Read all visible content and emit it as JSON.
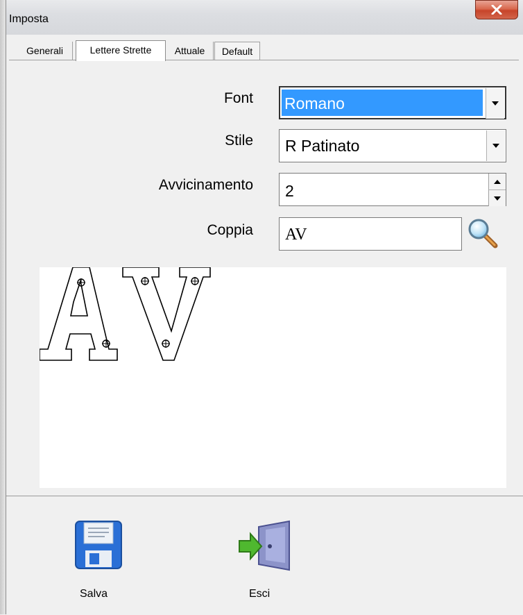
{
  "window": {
    "title": "Imposta",
    "close_glyph": "x"
  },
  "tabs": [
    {
      "label": "Generali"
    },
    {
      "label": "Lettere Strette"
    },
    {
      "label": "Attuale"
    },
    {
      "label": "Default"
    }
  ],
  "form": {
    "font_label": "Font",
    "font_value": "Romano",
    "style_label": "Stile",
    "style_value": "R Patinato",
    "spacing_label": "Avvicinamento",
    "spacing_value": "2",
    "pair_label": "Coppia",
    "pair_value": "AV"
  },
  "preview": {
    "text": "AV"
  },
  "actions": {
    "save_label": "Salva",
    "exit_label": "Esci"
  },
  "colors": {
    "selection": "#3399ff",
    "close_button": "#c7442a",
    "save_icon": "#2a6fd6",
    "exit_arrow": "#4fb82f"
  },
  "icons": {
    "search": "magnifier-icon",
    "save": "floppy-disk-icon",
    "exit": "door-exit-icon"
  }
}
